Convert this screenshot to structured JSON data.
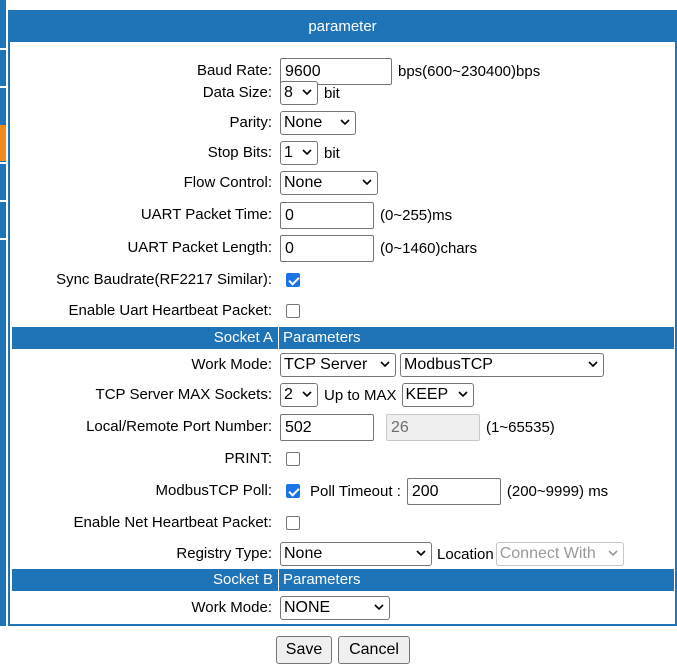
{
  "panel_title": "parameter",
  "uart": {
    "baud_rate": {
      "label": "Baud Rate:",
      "value": "9600",
      "suffix": "bps(600~230400)bps"
    },
    "data_size": {
      "label": "Data Size:",
      "value": "8",
      "suffix": "bit"
    },
    "parity": {
      "label": "Parity:",
      "value": "None"
    },
    "stop_bits": {
      "label": "Stop Bits:",
      "value": "1",
      "suffix": "bit"
    },
    "flow_control": {
      "label": "Flow Control:",
      "value": "None"
    },
    "packet_time": {
      "label": "UART Packet Time:",
      "value": "0",
      "suffix": "(0~255)ms"
    },
    "packet_length": {
      "label": "UART Packet Length:",
      "value": "0",
      "suffix": "(0~1460)chars"
    },
    "sync_baudrate": {
      "label": "Sync Baudrate(RF2217 Similar):",
      "checked": true
    },
    "uart_heartbeat": {
      "label": "Enable Uart Heartbeat Packet:",
      "checked": false
    }
  },
  "socket_a": {
    "header_left": "Socket A",
    "header_right": "Parameters",
    "work_mode": {
      "label": "Work Mode:",
      "value": "TCP Server",
      "protocol": "ModbusTCP"
    },
    "max_sockets": {
      "label": "TCP Server MAX Sockets:",
      "value": "2",
      "middle": "Up to MAX",
      "policy": "KEEP"
    },
    "port": {
      "label": "Local/Remote Port Number:",
      "local": "502",
      "remote": "26",
      "suffix": "(1~65535)"
    },
    "print": {
      "label": "PRINT:",
      "checked": false
    },
    "modbus_poll": {
      "label": "ModbusTCP Poll:",
      "checked": true,
      "timeout_label": "Poll Timeout :",
      "timeout": "200",
      "suffix": "(200~9999) ms"
    },
    "net_heartbeat": {
      "label": "Enable Net Heartbeat Packet:",
      "checked": false
    },
    "registry": {
      "label": "Registry Type:",
      "value": "None",
      "location_label": "Location",
      "location_value": "Connect With"
    }
  },
  "socket_b": {
    "header_left": "Socket B",
    "header_right": "Parameters",
    "work_mode": {
      "label": "Work Mode:",
      "value": "NONE"
    }
  },
  "buttons": {
    "save": "Save",
    "cancel": "Cancel"
  },
  "colors": {
    "accent": "#1f73b7",
    "nav_active": "#f08a1c",
    "checkbox": "#1a73e8"
  }
}
